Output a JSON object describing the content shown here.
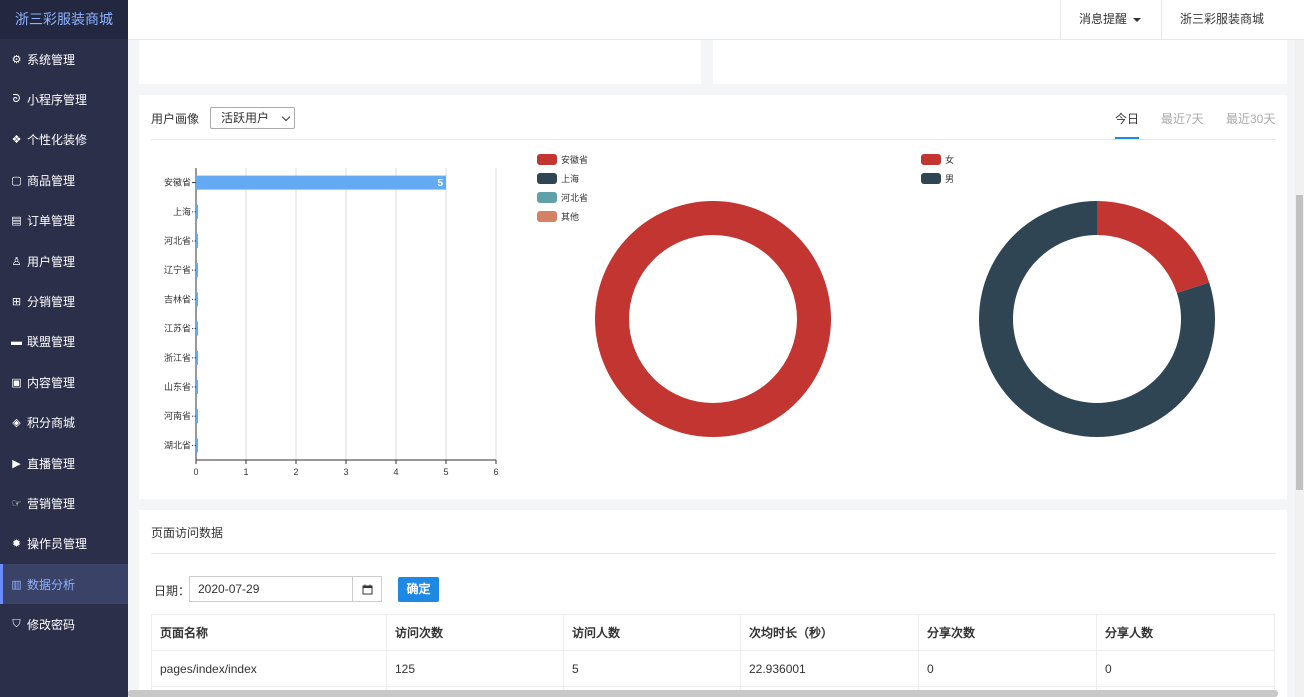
{
  "brand": "浙三彩服装商城",
  "sidebar": {
    "items": [
      {
        "label": "系统管理",
        "icon": "gear-outline-icon"
      },
      {
        "label": "小程序管理",
        "icon": "mini-program-icon"
      },
      {
        "label": "个性化装修",
        "icon": "palette-icon"
      },
      {
        "label": "商品管理",
        "icon": "shopping-bag-icon"
      },
      {
        "label": "订单管理",
        "icon": "clipboard-icon"
      },
      {
        "label": "用户管理",
        "icon": "user-icon"
      },
      {
        "label": "分销管理",
        "icon": "sitemap-icon"
      },
      {
        "label": "联盟管理",
        "icon": "store-icon"
      },
      {
        "label": "内容管理",
        "icon": "content-icon"
      },
      {
        "label": "积分商城",
        "icon": "cube-icon"
      },
      {
        "label": "直播管理",
        "icon": "play-icon"
      },
      {
        "label": "营销管理",
        "icon": "marketing-icon"
      },
      {
        "label": "操作员管理",
        "icon": "gear-icon"
      },
      {
        "label": "数据分析",
        "icon": "bar-chart-icon",
        "active": true
      },
      {
        "label": "修改密码",
        "icon": "shield-icon"
      }
    ]
  },
  "header": {
    "notifications": "消息提醒",
    "shop": "浙三彩服装商城"
  },
  "portrait": {
    "title": "用户画像",
    "select_value": "活跃用户",
    "tabs": [
      "今日",
      "最近7天",
      "最近30天"
    ],
    "active_tab": 0
  },
  "colors": {
    "bar": "#64aaf2",
    "red": "#c23531",
    "navy": "#2f4554",
    "teal": "#61a0a8",
    "orange": "#d48265",
    "accent": "#1e88e5"
  },
  "chart_data": [
    {
      "type": "bar",
      "orientation": "horizontal",
      "categories": [
        "安徽省",
        "上海",
        "河北省",
        "辽宁省",
        "吉林省",
        "江苏省",
        "浙江省",
        "山东省",
        "河南省",
        "湖北省"
      ],
      "values": [
        5,
        0,
        0,
        0,
        0,
        0,
        0,
        0,
        0,
        0
      ],
      "value_labels": [
        "5",
        "0",
        "0",
        "0",
        "0",
        "0",
        "0",
        "0",
        "0",
        "0"
      ],
      "xlim": [
        0,
        6
      ],
      "xticks": [
        "0",
        "1",
        "2",
        "3",
        "4",
        "5",
        "6"
      ],
      "grid": true
    },
    {
      "type": "pie",
      "donut": true,
      "labels": [
        "安徽省",
        "上海",
        "河北省",
        "其他"
      ],
      "values": [
        5,
        0,
        0,
        0
      ],
      "legend": "top-left"
    },
    {
      "type": "pie",
      "donut": true,
      "labels": [
        "女",
        "男"
      ],
      "values": [
        1,
        4
      ],
      "legend": "top-left"
    }
  ],
  "visits": {
    "title": "页面访问数据",
    "date_label": "日期：",
    "date_value": "2020-07-29",
    "confirm": "确定",
    "columns": [
      "页面名称",
      "访问次数",
      "访问人数",
      "次均时长（秒）",
      "分享次数",
      "分享人数"
    ],
    "rows": [
      [
        "pages/index/index",
        "125",
        "5",
        "22.936001",
        "0",
        "0"
      ],
      [
        "",
        "",
        "",
        "",
        "",
        ""
      ]
    ]
  }
}
